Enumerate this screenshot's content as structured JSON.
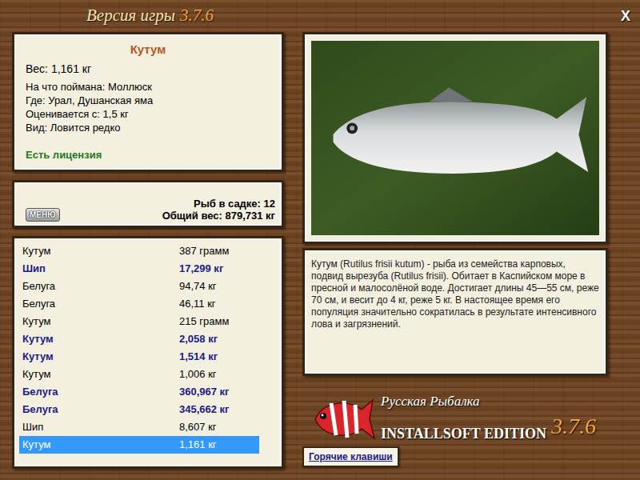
{
  "window": {
    "title": "Версия игры",
    "version": "3.7.6",
    "close": "X"
  },
  "fish": {
    "name": "Кутум",
    "lines": [
      "Вес: 1,161 кг",
      "На что поймана: Моллюск",
      "Где: Урал, Душанская яма",
      "Оценивается с: 1,5 кг",
      "Вид: Ловится редко"
    ],
    "license": "Есть лицензия"
  },
  "keepnet": {
    "menu_button": "МЕНЮ",
    "count": "Рыб в садке: 12",
    "total_weight": "Общий вес: 879,731 кг"
  },
  "catches": [
    {
      "name": "Кутум",
      "weight": "387 грамм",
      "trophy": false,
      "selected": false
    },
    {
      "name": "Шип",
      "weight": "17,299 кг",
      "trophy": true,
      "selected": false
    },
    {
      "name": "Белуга",
      "weight": "94,74 кг",
      "trophy": false,
      "selected": false
    },
    {
      "name": "Белуга",
      "weight": "46,11 кг",
      "trophy": false,
      "selected": false
    },
    {
      "name": "Кутум",
      "weight": "215 грамм",
      "trophy": false,
      "selected": false
    },
    {
      "name": "Кутум",
      "weight": "2,058 кг",
      "trophy": true,
      "selected": false
    },
    {
      "name": "Кутум",
      "weight": "1,514 кг",
      "trophy": true,
      "selected": false
    },
    {
      "name": "Кутум",
      "weight": "1,006 кг",
      "trophy": false,
      "selected": false
    },
    {
      "name": "Белуга",
      "weight": "360,967 кг",
      "trophy": true,
      "selected": false
    },
    {
      "name": "Белуга",
      "weight": "345,662 кг",
      "trophy": true,
      "selected": false
    },
    {
      "name": "Шип",
      "weight": "8,607 кг",
      "trophy": false,
      "selected": false
    },
    {
      "name": "Кутум",
      "weight": "1,161 кг",
      "trophy": false,
      "selected": true
    }
  ],
  "description": "Кутум (Rutilus frisii kutum) - рыба из семейства карповых, подвид вырезуба (Rutilus frisii). Обитает в Каспийском море в пресной и малосолёной воде. Достигает длины 45—55 см, реже 70 см, и весит до 4 кг, реже 5 кг. В настоящее время его популяция значительно сократилась в результате интенсивного лова и загрязнений.",
  "logo": {
    "title": "Русская Рыбалка",
    "edition": "INSTALLSOFT EDITION",
    "version": "3.7.6"
  },
  "hotkeys_button": "Горячие клавиши"
}
